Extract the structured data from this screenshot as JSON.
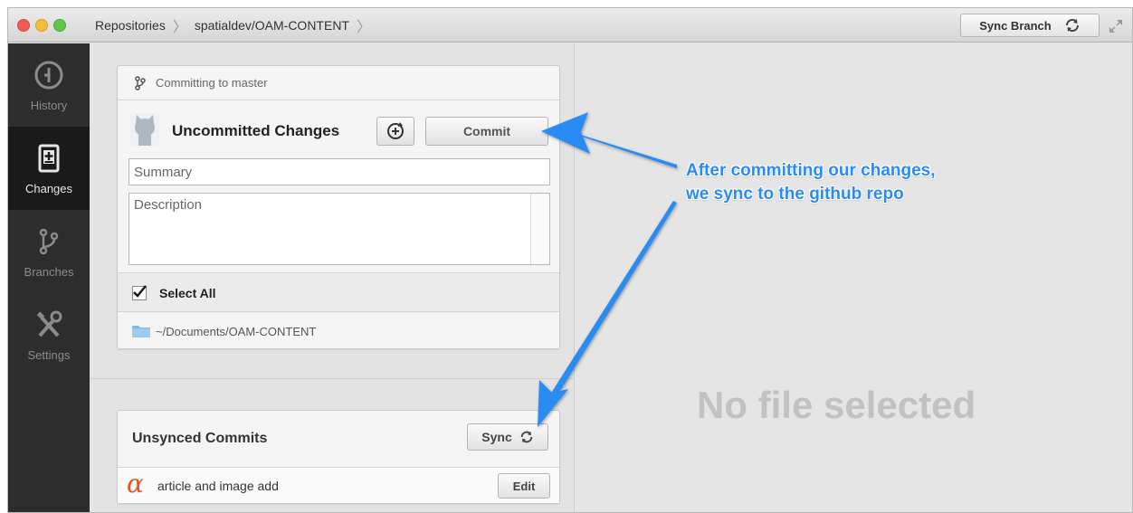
{
  "window": {
    "breadcrumbs": [
      "Repositories",
      "spatialdev/OAM-CONTENT"
    ],
    "sync_branch_label": "Sync Branch"
  },
  "sidebar": {
    "items": [
      {
        "label": "History",
        "icon": "history-icon",
        "active": false
      },
      {
        "label": "Changes",
        "icon": "changes-icon",
        "active": true
      },
      {
        "label": "Branches",
        "icon": "branch-icon",
        "active": false
      },
      {
        "label": "Settings",
        "icon": "settings-icon",
        "active": false
      }
    ]
  },
  "commit_panel": {
    "branch_text": "Committing to master",
    "title": "Uncommitted Changes",
    "commit_label": "Commit",
    "summary_placeholder": "Summary",
    "description_placeholder": "Description",
    "select_all_label": "Select All",
    "select_all_checked": true,
    "repo_path": "~/Documents/OAM-CONTENT"
  },
  "unsynced": {
    "title": "Unsynced Commits",
    "sync_label": "Sync",
    "commits": [
      {
        "message": "article and image add",
        "edit_label": "Edit"
      }
    ]
  },
  "detail": {
    "empty_text": "No file selected"
  },
  "annotation": {
    "line1": "After committing our changes,",
    "line2": "we sync to the github repo",
    "color": "#2a8cf2"
  },
  "colors": {
    "sidebar_bg": "#2d2d2d",
    "accent_red": "#f35a52",
    "accent_yellow": "#f7bd3a",
    "accent_green": "#5fc84b",
    "alpha_orange": "#e8541e"
  }
}
